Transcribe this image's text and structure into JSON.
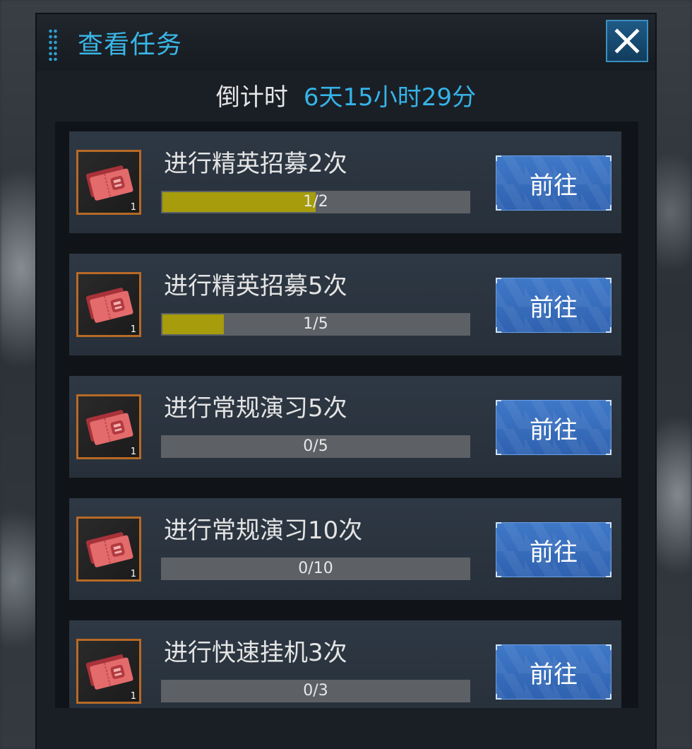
{
  "header": {
    "title": "查看任务",
    "close_icon": "close-icon"
  },
  "countdown": {
    "label": "倒计时",
    "value": "6天15小时29分"
  },
  "colors": {
    "title": "#3ab6e6",
    "countdown_value": "#36b3e8",
    "progress_fill": "#a69c0c",
    "go_button": "#3a6fc0",
    "reward_border": "#b76a26"
  },
  "tasks": [
    {
      "name": "进行精英招募2次",
      "progress_text": "1/2",
      "progress": 0.5,
      "reward_count": "1",
      "reward_icon": "recruit-ticket-icon",
      "button_label": "前往"
    },
    {
      "name": "进行精英招募5次",
      "progress_text": "1/5",
      "progress": 0.2,
      "reward_count": "1",
      "reward_icon": "recruit-ticket-icon",
      "button_label": "前往"
    },
    {
      "name": "进行常规演习5次",
      "progress_text": "0/5",
      "progress": 0,
      "reward_count": "1",
      "reward_icon": "recruit-ticket-icon",
      "button_label": "前往"
    },
    {
      "name": "进行常规演习10次",
      "progress_text": "0/10",
      "progress": 0,
      "reward_count": "1",
      "reward_icon": "recruit-ticket-icon",
      "button_label": "前往"
    },
    {
      "name": "进行快速挂机3次",
      "progress_text": "0/3",
      "progress": 0,
      "reward_count": "1",
      "reward_icon": "recruit-ticket-icon",
      "button_label": "前往"
    }
  ]
}
